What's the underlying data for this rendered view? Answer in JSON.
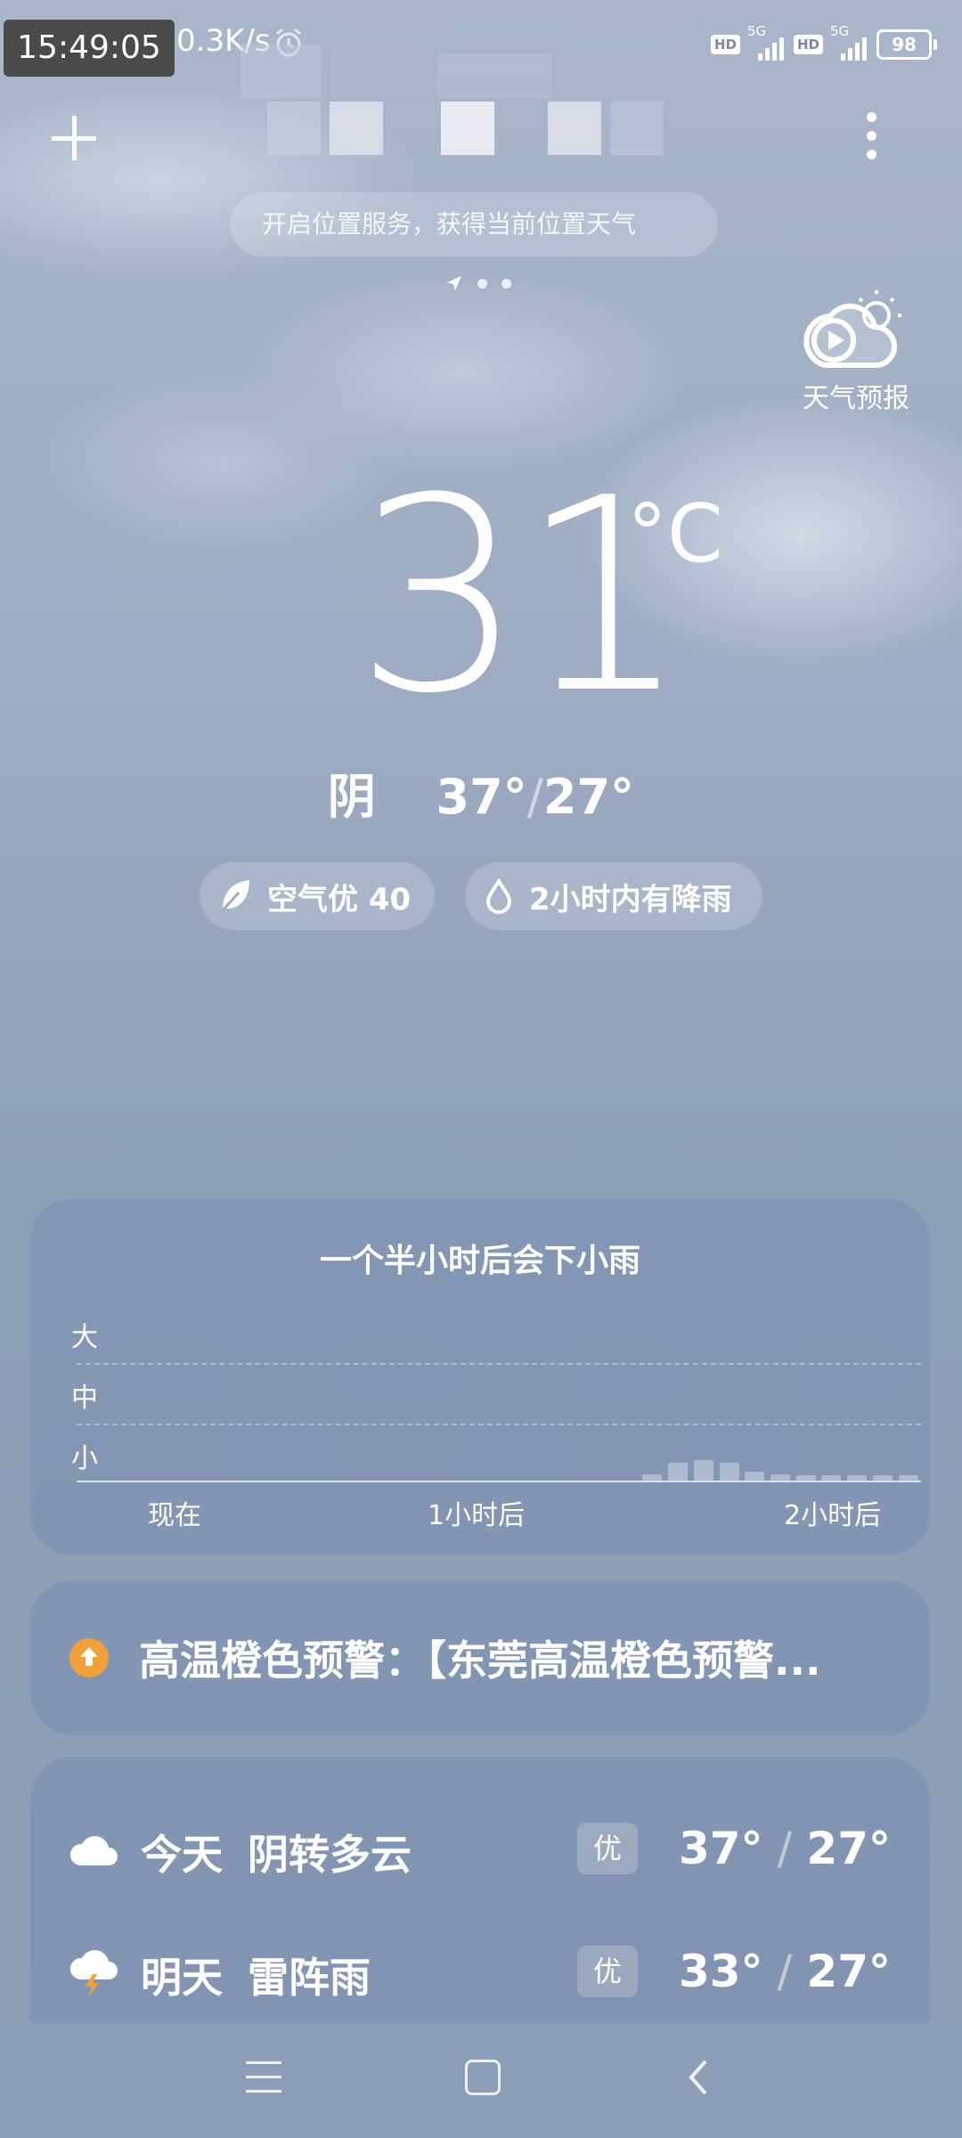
{
  "status_bar": {
    "time": "15:49:05",
    "network_speed": "0.3K/s",
    "hd_label": "HD",
    "signal_label": "5G",
    "battery": "98"
  },
  "top_bar": {
    "location_banner": "开启位置服务，获得当前位置天气"
  },
  "forecast_video": {
    "label": "天气预报"
  },
  "current": {
    "temperature": "31",
    "unit": "°C",
    "condition": "阴",
    "high": "37°",
    "low": "27°",
    "aqi_label": "空气优 40",
    "rain_hint": "2小时内有降雨"
  },
  "rain_card": {
    "title": "一个半小时后会下小雨",
    "levels": [
      "大",
      "中",
      "小"
    ],
    "time_ticks": [
      "现在",
      "1小时后",
      "2小时后"
    ],
    "chart_data": {
      "type": "bar",
      "series": [
        {
          "values": [
            0,
            0,
            0,
            0,
            0,
            0,
            0,
            0,
            0,
            0,
            0,
            0,
            0,
            0,
            0,
            0,
            0,
            0,
            0,
            0,
            0,
            0,
            0.1,
            0.3,
            0.35,
            0.3,
            0.15,
            0.1,
            0.08,
            0.08,
            0.08,
            0.08,
            0.08
          ]
        }
      ],
      "ylim": [
        0,
        3
      ]
    }
  },
  "warning": {
    "text": "高温橙色预警：【东莞高温橙色预警..."
  },
  "daily": [
    {
      "day": "今天",
      "condition": "阴转多云",
      "aqi": "优",
      "high": "37°",
      "low": "27°",
      "icon": "cloud-icon"
    },
    {
      "day": "明天",
      "condition": "雷阵雨",
      "aqi": "优",
      "high": "33°",
      "low": "27°",
      "icon": "thunderstorm-icon"
    }
  ],
  "colors": {
    "warning_orange": "#f0a13a"
  }
}
